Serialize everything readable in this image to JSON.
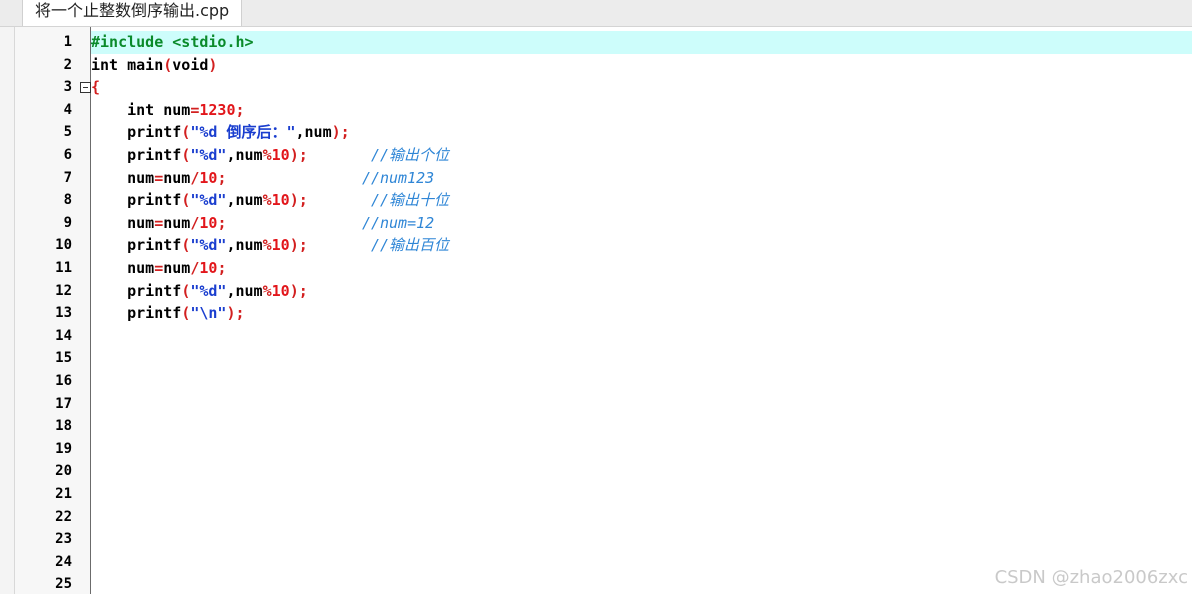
{
  "tab": {
    "filename": "将一个止整数倒序输出.cpp"
  },
  "line_numbers": [
    "1",
    "2",
    "3",
    "4",
    "5",
    "6",
    "7",
    "8",
    "9",
    "10",
    "11",
    "12",
    "13",
    "14",
    "15",
    "16",
    "17",
    "18",
    "19",
    "20",
    "21",
    "22",
    "23",
    "24",
    "25"
  ],
  "code": {
    "l1": {
      "pre": "#include <stdio.h>"
    },
    "l2": {
      "kw": "int",
      "name": "main",
      "open": "(",
      "arg": "void",
      "close": ")"
    },
    "l3": {
      "brace": "{"
    },
    "l4": {
      "kw": "int",
      "var": "num",
      "eq": "=",
      "val": "1230",
      "semi": ";"
    },
    "l5": {
      "fn": "printf",
      "open": "(",
      "str": "\"%d 倒序后：\"",
      "comma": ",",
      "var": "num",
      "close": ")",
      "semi": ";"
    },
    "l6": {
      "fn": "printf",
      "open": "(",
      "str": "\"%d\"",
      "comma": ",",
      "var": "num",
      "mod": "%",
      "val": "10",
      "close": ")",
      "semi": ";",
      "comment": "//输出个位"
    },
    "l7": {
      "lhs": "num",
      "eq": "=",
      "rhs": "num",
      "div": "/",
      "val": "10",
      "semi": ";",
      "comment": "//num123"
    },
    "l8": {
      "fn": "printf",
      "open": "(",
      "str": "\"%d\"",
      "comma": ",",
      "var": "num",
      "mod": "%",
      "val": "10",
      "close": ")",
      "semi": ";",
      "comment": "//输出十位"
    },
    "l9": {
      "lhs": "num",
      "eq": "=",
      "rhs": "num",
      "div": "/",
      "val": "10",
      "semi": ";",
      "comment": "//num=12"
    },
    "l10": {
      "fn": "printf",
      "open": "(",
      "str": "\"%d\"",
      "comma": ",",
      "var": "num",
      "mod": "%",
      "val": "10",
      "close": ")",
      "semi": ";",
      "comment": "//输出百位"
    },
    "l11": {
      "lhs": "num",
      "eq": "=",
      "rhs": "num",
      "div": "/",
      "val": "10",
      "semi": ";"
    },
    "l12": {
      "fn": "printf",
      "open": "(",
      "str": "\"%d\"",
      "comma": ",",
      "var": "num",
      "mod": "%",
      "val": "10",
      "close": ")",
      "semi": ";"
    },
    "l13": {
      "fn": "printf",
      "open": "(",
      "str": "\"\\n\"",
      "close": ")",
      "semi": ";"
    }
  },
  "watermark": "CSDN @zhao2006zxc",
  "colors": {
    "current_line": "#cdfdfb",
    "string": "#1a3ecf",
    "number": "#e2161b",
    "comment": "#2f86d6",
    "preprocessor": "#0a8a2a"
  }
}
